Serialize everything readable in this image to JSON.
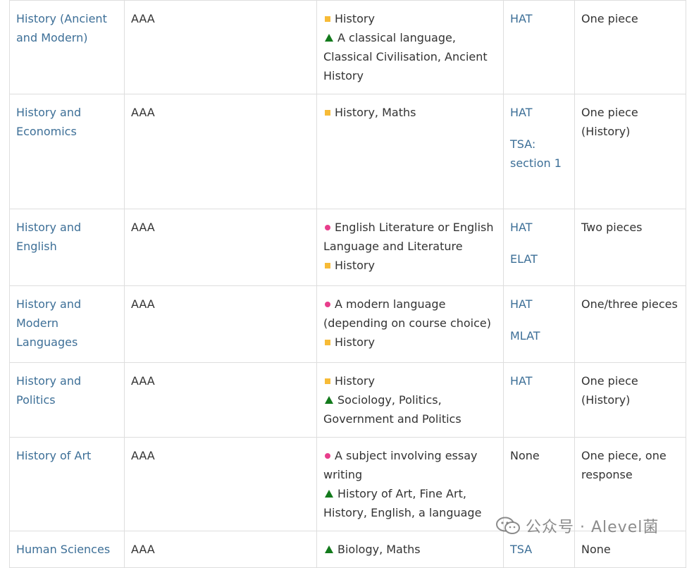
{
  "rows": [
    {
      "course": "History (Ancient and Modern)",
      "grades": "AAA",
      "subjects": [
        {
          "marker": "square",
          "text": "History"
        },
        {
          "marker": "triangle",
          "text": "A classical language, Classical Civilisation, Ancient History"
        }
      ],
      "tests": [
        {
          "text": "HAT",
          "link": true
        }
      ],
      "written_work": "One piece"
    },
    {
      "course": "History and Economics",
      "grades": "AAA",
      "subjects": [
        {
          "marker": "square",
          "text": "History, Maths"
        }
      ],
      "tests": [
        {
          "text": "HAT",
          "link": true
        },
        {
          "text": "TSA: section 1",
          "link": true
        }
      ],
      "written_work": "One piece (History)"
    },
    {
      "course": "History and English",
      "grades": "AAA",
      "subjects": [
        {
          "marker": "dot",
          "text": "English Literature or English Language and Literature"
        },
        {
          "marker": "square",
          "text": "History"
        }
      ],
      "tests": [
        {
          "text": "HAT",
          "link": true
        },
        {
          "text": "ELAT",
          "link": true
        }
      ],
      "written_work": "Two pieces"
    },
    {
      "course": "History and Modern Languages",
      "grades": "AAA",
      "subjects": [
        {
          "marker": "dot",
          "text": "A modern language (depending on course choice)"
        },
        {
          "marker": "square",
          "text": "History"
        }
      ],
      "tests": [
        {
          "text": "HAT",
          "link": true
        },
        {
          "text": "MLAT",
          "link": true
        }
      ],
      "written_work": "One/three pieces"
    },
    {
      "course": "History and Politics",
      "grades": "AAA",
      "subjects": [
        {
          "marker": "square",
          "text": "History"
        },
        {
          "marker": "triangle",
          "text": "Sociology, Politics, Government and Politics"
        }
      ],
      "tests": [
        {
          "text": "HAT",
          "link": true
        }
      ],
      "written_work": "One piece (History)"
    },
    {
      "course": "History of Art",
      "grades": "AAA",
      "subjects": [
        {
          "marker": "dot",
          "text": "A subject involving essay writing"
        },
        {
          "marker": "triangle",
          "text": "History of Art, Fine Art, History, English, a language"
        }
      ],
      "tests": [
        {
          "text": "None",
          "link": false
        }
      ],
      "written_work": "One piece, one response"
    },
    {
      "course": "Human Sciences",
      "grades": "AAA",
      "subjects": [
        {
          "marker": "triangle",
          "text": "Biology, Maths"
        }
      ],
      "tests": [
        {
          "text": "TSA",
          "link": true
        }
      ],
      "written_work": "None"
    }
  ],
  "watermark": {
    "text": "公众号 · Alevel菌",
    "icon": "wechat-icon"
  },
  "colors": {
    "link": "#3d6f97",
    "square": "#f7bb37",
    "triangle": "#137a1c",
    "dot": "#e83e8c",
    "border": "#dedede"
  }
}
